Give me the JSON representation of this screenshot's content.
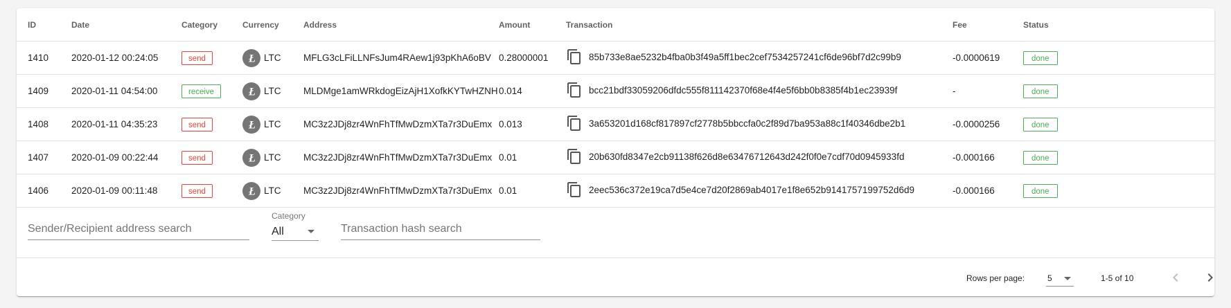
{
  "table": {
    "headers": {
      "id": "ID",
      "date": "Date",
      "category": "Category",
      "currency": "Currency",
      "address": "Address",
      "amount": "Amount",
      "transaction": "Transaction",
      "fee": "Fee",
      "status": "Status"
    },
    "rows": [
      {
        "id": "1410",
        "date": "2020-01-12 00:24:05",
        "category": "send",
        "currency": "LTC",
        "address": "MFLG3cLFiLLNFsJum4RAew1j93pKhA6oBV",
        "amount": "0.28000001",
        "transaction": "85b733e8ae5232b4fba0b3f49a5ff1bec2cef7534257241cf6de96bf7d2c99b9",
        "fee": "-0.0000619",
        "status": "done"
      },
      {
        "id": "1409",
        "date": "2020-01-11 04:54:00",
        "category": "receive",
        "currency": "LTC",
        "address": "MLDMge1amWRkdogEizAjH1XofkKYTwHZNH",
        "amount": "0.014",
        "transaction": "bcc21bdf33059206dfdc555f811142370f68e4f4e5f6bb0b8385f4b1ec23939f",
        "fee": "-",
        "status": "done"
      },
      {
        "id": "1408",
        "date": "2020-01-11 04:35:23",
        "category": "send",
        "currency": "LTC",
        "address": "MC3z2JDj8zr4WnFhTfMwDzmXTa7r3DuEmx",
        "amount": "0.013",
        "transaction": "3a653201d168cf817897cf2778b5bbccfa0c2f89d7ba953a88c1f40346dbe2b1",
        "fee": "-0.0000256",
        "status": "done"
      },
      {
        "id": "1407",
        "date": "2020-01-09 00:22:44",
        "category": "send",
        "currency": "LTC",
        "address": "MC3z2JDj8zr4WnFhTfMwDzmXTa7r3DuEmx",
        "amount": "0.01",
        "transaction": "20b630fd8347e2cb91138f626d8e63476712643d242f0f0e7cdf70d0945933fd",
        "fee": "-0.000166",
        "status": "done"
      },
      {
        "id": "1406",
        "date": "2020-01-09 00:11:48",
        "category": "send",
        "currency": "LTC",
        "address": "MC3z2JDj8zr4WnFhTfMwDzmXTa7r3DuEmx",
        "amount": "0.01",
        "transaction": "2eec536c372e19ca7d5e4ce7d20f2869ab4017e1f8e652b9141757199752d6d9",
        "fee": "-0.000166",
        "status": "done"
      }
    ]
  },
  "filters": {
    "address_search_placeholder": "Sender/Recipient address search",
    "category_label": "Category",
    "category_value": "All",
    "tx_search_placeholder": "Transaction hash search"
  },
  "pagination": {
    "rows_per_page_label": "Rows per page:",
    "rows_per_page_value": "5",
    "range": "1-5 of 10"
  },
  "icons": {
    "currency": "litecoin-icon",
    "copy": "copy-icon",
    "prev": "chevron-left-icon",
    "next": "chevron-right-icon"
  },
  "colors": {
    "send": "#f44336",
    "receive": "#4caf50",
    "done": "#4caf50",
    "currency_icon_bg": "#757575"
  }
}
